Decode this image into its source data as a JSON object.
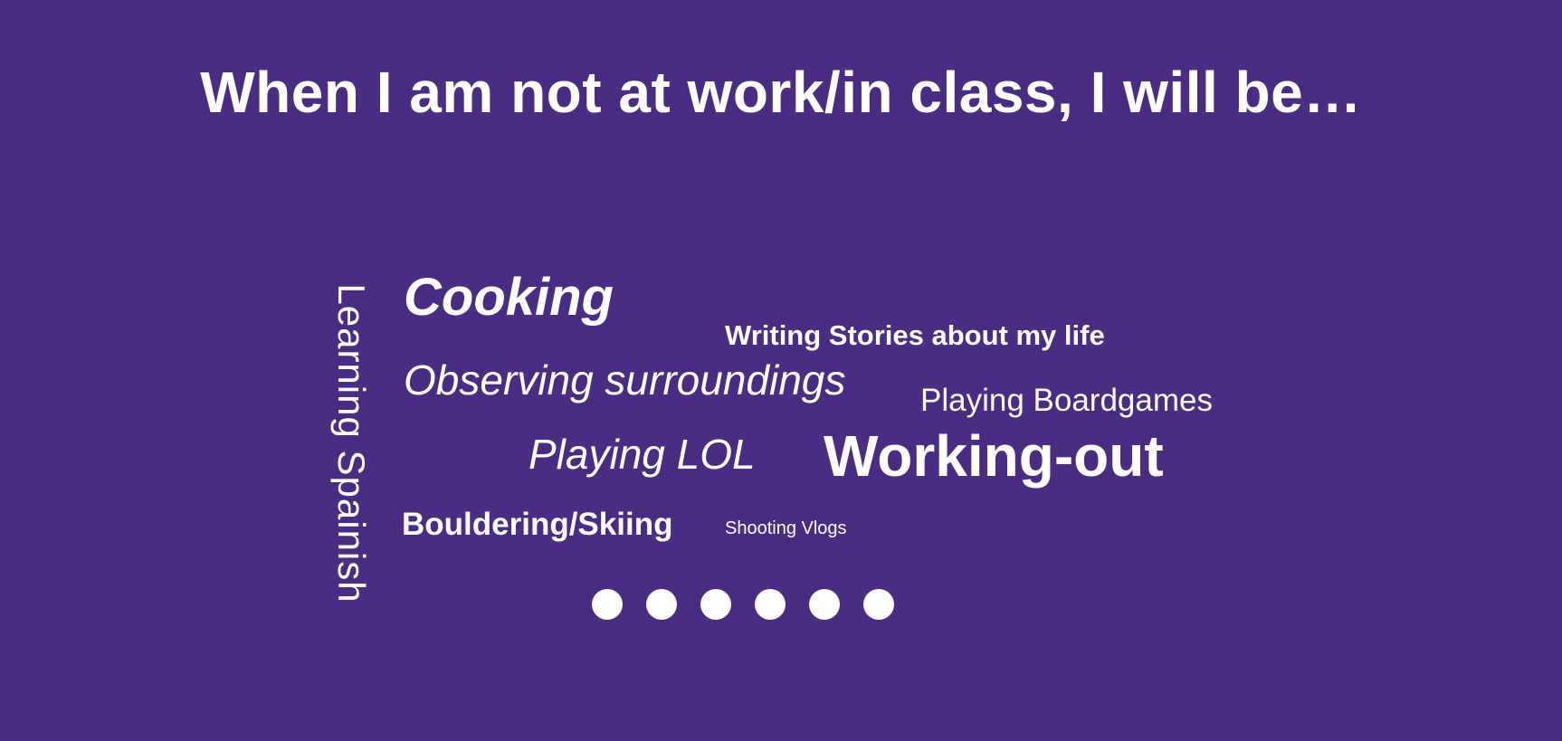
{
  "slide": {
    "title": "When I am not at work/in class, I will be…",
    "background_color": "#4a2d82",
    "text_color": "#ffffff"
  },
  "word_cloud": {
    "cooking": "Cooking",
    "writing": "Writing Stories about my life",
    "observing": "Observing surroundings",
    "boardgames": "Playing Boardgames",
    "lol": "Playing LOL",
    "workout": "Working-out",
    "bouldering": "Bouldering/Skiing",
    "vlogs": "Shooting Vlogs",
    "spanish": "Learning Spainish"
  },
  "pagination": {
    "dot_count": 6
  }
}
